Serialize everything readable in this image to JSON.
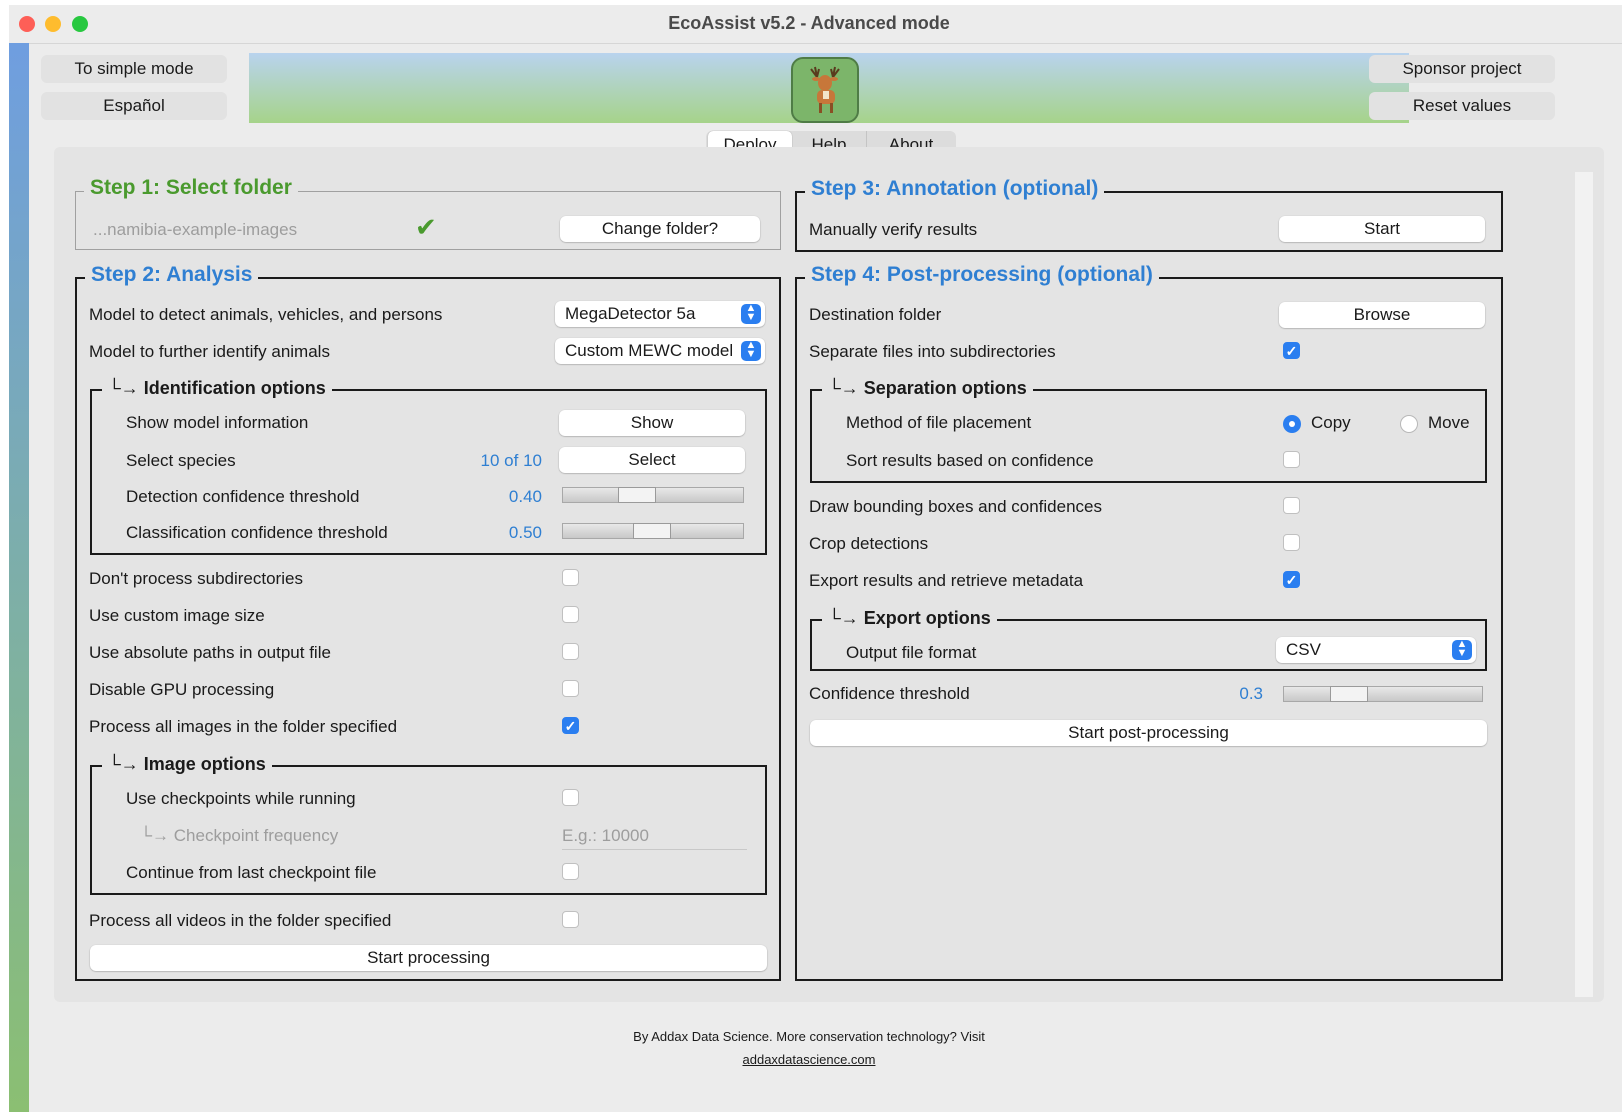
{
  "window": {
    "title": "EcoAssist v5.2 - Advanced mode"
  },
  "colors": {
    "accent": "#2a7ef0",
    "step_green": "#4a9a2e",
    "step_blue": "#2f7fd2",
    "close": "#fe5f57",
    "minimize": "#febc2e",
    "zoom": "#28c840"
  },
  "header": {
    "simple_mode": "To simple mode",
    "language": "Español",
    "sponsor": "Sponsor project",
    "reset": "Reset values",
    "logo_icon": "deer-icon"
  },
  "tabs": [
    {
      "label": "Deploy"
    },
    {
      "label": "Help"
    },
    {
      "label": "About"
    }
  ],
  "step1": {
    "title": "Step 1: Select folder",
    "folder": "...namibia-example-images",
    "check_icon": "checkmark-icon",
    "change": "Change folder?"
  },
  "step2": {
    "title": "Step 2: Analysis",
    "detect_label": "Model to detect animals, vehicles, and persons",
    "detect_value": "MegaDetector 5a",
    "identify_label": "Model to further identify animals",
    "identify_value": "Custom MEWC model",
    "id_options": {
      "title": "Identification options",
      "show_info_label": "Show model information",
      "show_btn": "Show",
      "species_label": "Select species",
      "species_count": "10 of 10",
      "select_btn": "Select",
      "det_conf_label": "Detection confidence threshold",
      "det_conf_value": "0.40",
      "cls_conf_label": "Classification confidence threshold",
      "cls_conf_value": "0.50"
    },
    "no_subdirs": "Don't process subdirectories",
    "custom_size": "Use custom image size",
    "abs_paths": "Use absolute paths in output file",
    "disable_gpu": "Disable GPU processing",
    "process_images": "Process all images in the folder specified",
    "image_options": {
      "title": "Image options",
      "checkpoints": "Use checkpoints while running",
      "checkpoint_freq": "Checkpoint frequency",
      "checkpoint_placeholder": "E.g.: 10000",
      "continue": "Continue from last checkpoint file"
    },
    "process_videos": "Process all videos in the folder specified",
    "start": "Start processing"
  },
  "step3": {
    "title": "Step 3: Annotation (optional)",
    "verify_label": "Manually verify results",
    "start": "Start"
  },
  "step4": {
    "title": "Step 4: Post-processing (optional)",
    "dest_label": "Destination folder",
    "browse": "Browse",
    "separate_label": "Separate files into subdirectories",
    "sep_options": {
      "title": "Separation options",
      "method_label": "Method of file placement",
      "copy": "Copy",
      "move": "Move",
      "sort_label": "Sort results based on confidence"
    },
    "draw_boxes": "Draw bounding boxes and confidences",
    "crop": "Crop detections",
    "export": "Export results and retrieve metadata",
    "export_options": {
      "title": "Export options",
      "format_label": "Output file format",
      "format_value": "CSV"
    },
    "conf_label": "Confidence threshold",
    "conf_value": "0.3",
    "start": "Start post-processing"
  },
  "footer": {
    "text": "By Addax Data Science. More conservation technology? Visit",
    "link": "addaxdatascience.com"
  }
}
